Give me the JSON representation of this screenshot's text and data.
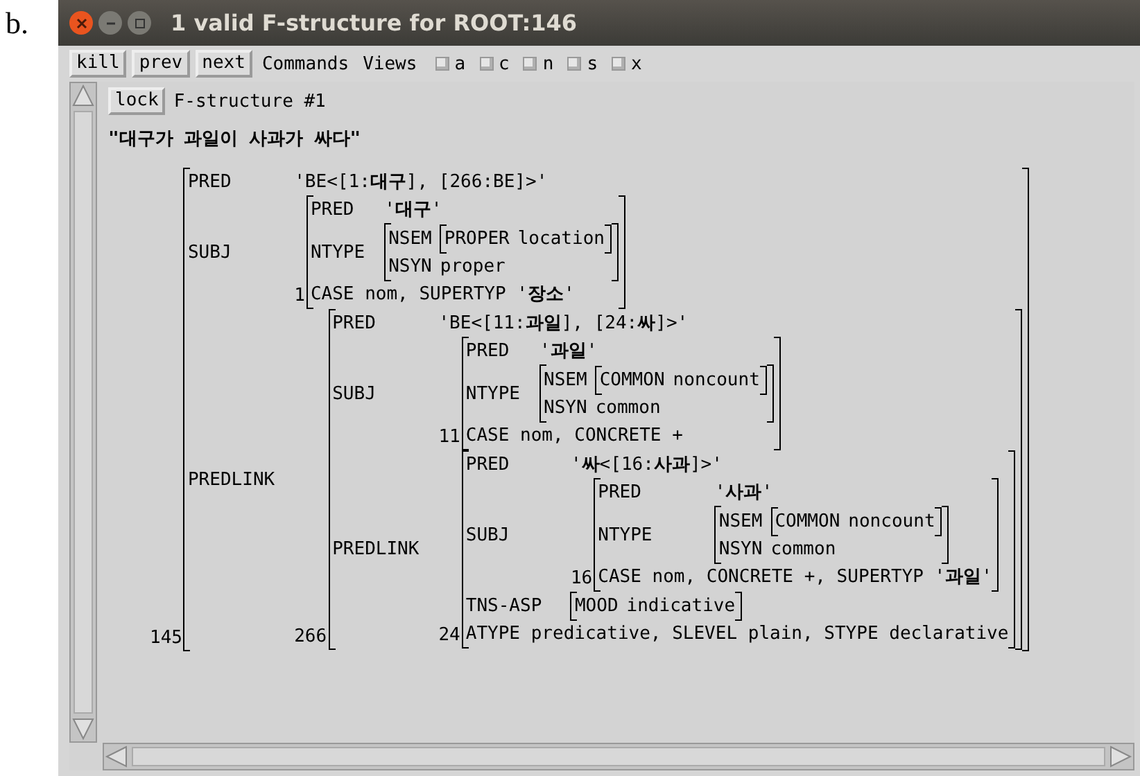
{
  "label": "b.",
  "window": {
    "title": "1 valid F-structure for ROOT:146"
  },
  "toolbar": {
    "buttons": [
      "kill",
      "prev",
      "next"
    ],
    "menus": [
      "Commands",
      "Views"
    ],
    "checkboxes": [
      {
        "label": "a",
        "checked": false
      },
      {
        "label": "c",
        "checked": false
      },
      {
        "label": "n",
        "checked": false
      },
      {
        "label": "s",
        "checked": false
      },
      {
        "label": "x",
        "checked": false
      }
    ]
  },
  "panel": {
    "lock_button": "lock",
    "heading": "F-structure #1",
    "sentence": "\"대구가 과일이 사과가 싸다\"",
    "fstructure": {
      "index": "145",
      "rows": [
        {
          "kind": "atom",
          "name": "PRED",
          "value": "'BE<[1:**대구**], [266:BE]>'"
        },
        {
          "kind": "matrix",
          "name": "SUBJ",
          "fs": {
            "index": "1",
            "rows": [
              {
                "kind": "atom",
                "name": "PRED",
                "value": "'**대구**'"
              },
              {
                "kind": "matrix",
                "name": "NTYPE",
                "fs": {
                  "rows": [
                    {
                      "kind": "matrix",
                      "name": "NSEM",
                      "fs": {
                        "rows": [
                          {
                            "kind": "atom",
                            "name": "PROPER",
                            "value": "location"
                          }
                        ]
                      }
                    },
                    {
                      "kind": "atom",
                      "name": "NSYN",
                      "value": "proper"
                    }
                  ]
                }
              },
              {
                "kind": "flat",
                "text": "CASE nom, SUPERTYP '**장소**'"
              }
            ]
          }
        },
        {
          "kind": "matrix",
          "name": "PREDLINK",
          "fs": {
            "index": "266",
            "rows": [
              {
                "kind": "atom",
                "name": "PRED",
                "value": "'BE<[11:**과일**], [24:**싸**]>'"
              },
              {
                "kind": "matrix",
                "name": "SUBJ",
                "fs": {
                  "index": "11",
                  "rows": [
                    {
                      "kind": "atom",
                      "name": "PRED",
                      "value": "'**과일**'"
                    },
                    {
                      "kind": "matrix",
                      "name": "NTYPE",
                      "fs": {
                        "rows": [
                          {
                            "kind": "matrix",
                            "name": "NSEM",
                            "fs": {
                              "rows": [
                                {
                                  "kind": "atom",
                                  "name": "COMMON",
                                  "value": "noncount"
                                }
                              ]
                            }
                          },
                          {
                            "kind": "atom",
                            "name": "NSYN",
                            "value": "common"
                          }
                        ]
                      }
                    },
                    {
                      "kind": "flat",
                      "text": "CASE nom, CONCRETE +"
                    }
                  ]
                }
              },
              {
                "kind": "matrix",
                "name": "PREDLINK",
                "fs": {
                  "index": "24",
                  "rows": [
                    {
                      "kind": "atom",
                      "name": "PRED",
                      "value": "'**싸**<[16:**사과**]>'"
                    },
                    {
                      "kind": "matrix",
                      "name": "SUBJ",
                      "fs": {
                        "index": "16",
                        "rows": [
                          {
                            "kind": "atom",
                            "name": "PRED",
                            "value": "'**사과**'"
                          },
                          {
                            "kind": "matrix",
                            "name": "NTYPE",
                            "fs": {
                              "rows": [
                                {
                                  "kind": "matrix",
                                  "name": "NSEM",
                                  "fs": {
                                    "rows": [
                                      {
                                        "kind": "atom",
                                        "name": "COMMON",
                                        "value": "noncount"
                                      }
                                    ]
                                  }
                                },
                                {
                                  "kind": "atom",
                                  "name": "NSYN",
                                  "value": "common"
                                }
                              ]
                            }
                          },
                          {
                            "kind": "flat",
                            "text": "CASE nom, CONCRETE +, SUPERTYP '**과일**'"
                          }
                        ]
                      }
                    },
                    {
                      "kind": "matrix",
                      "name": "TNS-ASP",
                      "fs": {
                        "rows": [
                          {
                            "kind": "atom",
                            "name": "MOOD",
                            "value": "indicative"
                          }
                        ]
                      }
                    },
                    {
                      "kind": "flat",
                      "text": "ATYPE predicative, SLEVEL plain, STYPE declarative"
                    }
                  ]
                }
              }
            ]
          }
        }
      ]
    }
  }
}
